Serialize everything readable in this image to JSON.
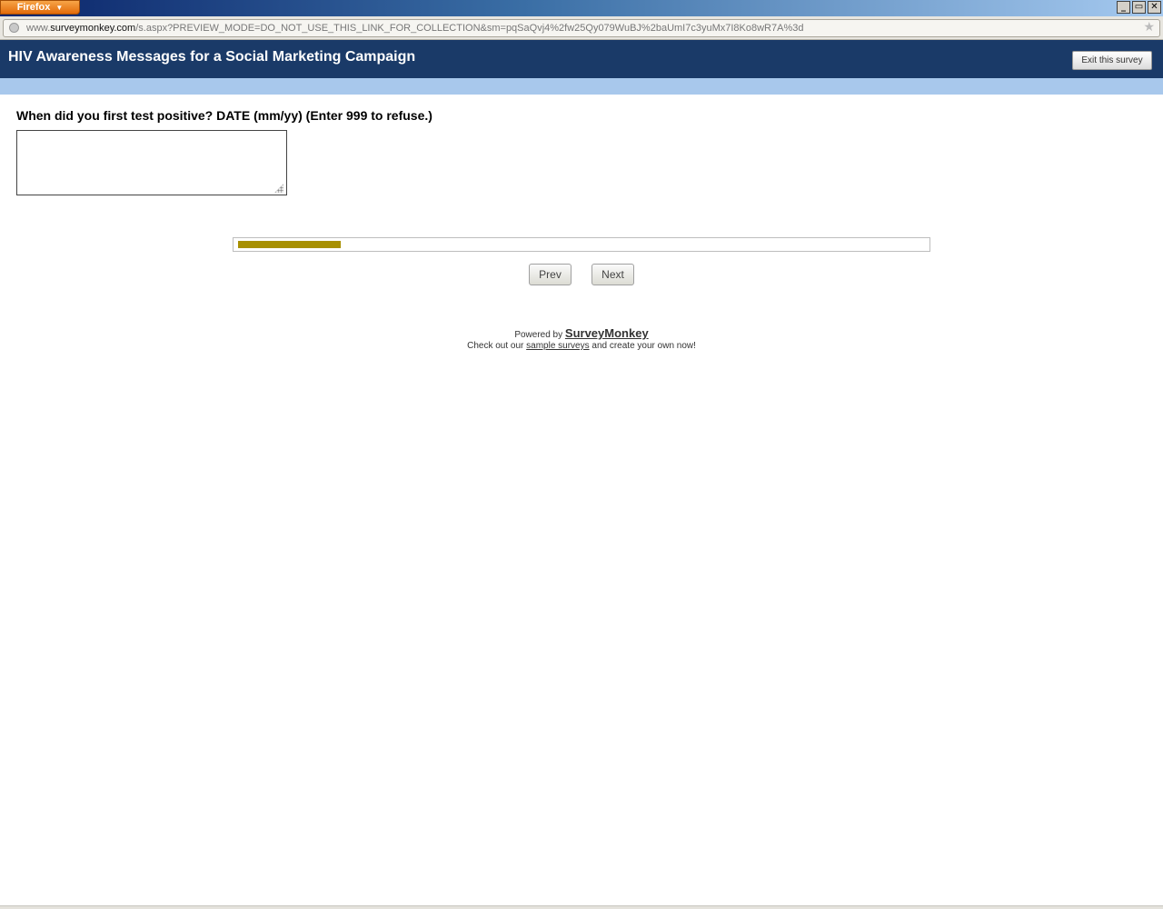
{
  "browser": {
    "app_button_label": "Firefox",
    "url_prefix": "www.",
    "url_domain": "surveymonkey.com",
    "url_path": "/s.aspx?PREVIEW_MODE=DO_NOT_USE_THIS_LINK_FOR_COLLECTION&sm=pqSaQvj4%2fw25Qy079WuBJ%2baUmI7c3yuMx7I8Ko8wR7A%3d",
    "window_buttons": [
      "_",
      "▭",
      "✕"
    ]
  },
  "survey": {
    "title": "HIV Awareness Messages for a Social Marketing Campaign",
    "exit_label": "Exit this survey"
  },
  "question": {
    "text": "When did you first test positive? DATE (mm/yy) (Enter 999 to refuse.)",
    "answer_value": ""
  },
  "progress": {
    "fraction": 0.15
  },
  "navigation": {
    "prev_label": "Prev",
    "next_label": "Next"
  },
  "footer": {
    "powered_prefix": "Powered by",
    "brand_link": "SurveyMonkey",
    "checkout_prefix": "Check out our",
    "sample_link": "sample surveys",
    "checkout_suffix": "and create your own now!"
  },
  "colors": {
    "header_bg": "#1a3a68",
    "header_stripe": "#a8c8ec",
    "progress_fill": "#a89000"
  }
}
